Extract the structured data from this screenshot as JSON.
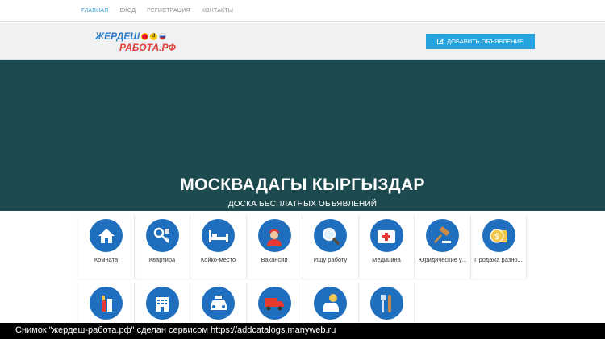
{
  "topnav": {
    "items": [
      {
        "label": "ГЛАВНАЯ"
      },
      {
        "label": "ВХОД"
      },
      {
        "label": "РЕГИСТРАЦИЯ"
      },
      {
        "label": "КОНТАКТЫ"
      }
    ]
  },
  "header": {
    "logo_line1": "ЖЕРДЕШ",
    "logo_line2": "РАБОТА.РФ",
    "add_button_label": "ДОБАВИТЬ ОБЪЯВЛЕНИЕ"
  },
  "hero": {
    "title": "МОСКВАДАГЫ КЫРГЫЗДАР",
    "subtitle": "ДОСКА БЕСПЛАТНЫХ ОБЪЯВЛЕНИЙ"
  },
  "categories": {
    "row1": [
      {
        "label": "Комната",
        "icon": "house-icon"
      },
      {
        "label": "Квартира",
        "icon": "keys-icon"
      },
      {
        "label": "Койко-место",
        "icon": "bed-icon"
      },
      {
        "label": "Вакансии",
        "icon": "worker-icon"
      },
      {
        "label": "Ищу работу",
        "icon": "magnifier-icon"
      },
      {
        "label": "Медицина",
        "icon": "medical-kit-icon"
      },
      {
        "label": "Юридические у...",
        "icon": "gavel-icon"
      },
      {
        "label": "Продажа разно...",
        "icon": "coins-icon"
      }
    ],
    "row2": [
      {
        "label": "",
        "icon": "cosmetics-icon"
      },
      {
        "label": "",
        "icon": "hotel-icon"
      },
      {
        "label": "",
        "icon": "taxi-icon"
      },
      {
        "label": "",
        "icon": "truck-icon"
      },
      {
        "label": "",
        "icon": "car-sale-icon"
      },
      {
        "label": "",
        "icon": "food-icon"
      }
    ]
  },
  "caption": "Снимок \"жердеш-работа.рф\" сделан сервисом https://addcatalogs.manyweb.ru",
  "colors": {
    "accent": "#25a3e0",
    "hero_bg": "#1d4a4f",
    "icon_bg": "#1f6fbe"
  }
}
